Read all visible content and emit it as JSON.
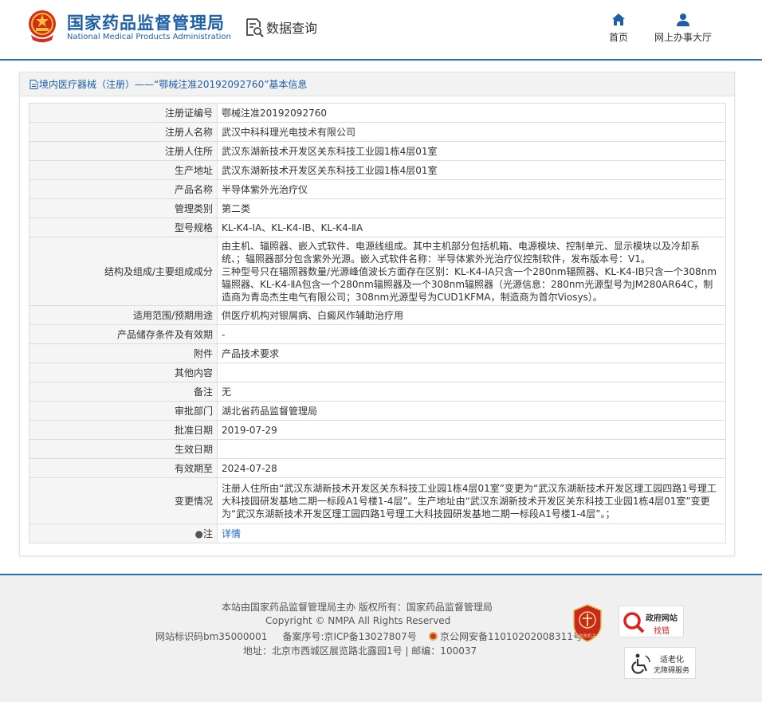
{
  "header": {
    "site_name_cn": "国家药品监督管理局",
    "site_name_en": "National Medical Products Administration",
    "query_label": "数据查询",
    "nav": {
      "home": "首页",
      "online_hall": "网上办事大厅"
    }
  },
  "panel": {
    "title": "境内医疗器械（注册）——“鄂械注准20192092760”基本信息",
    "rows": [
      {
        "label": "注册证编号",
        "value": "鄂械注准20192092760"
      },
      {
        "label": "注册人名称",
        "value": "武汉中科科理光电技术有限公司"
      },
      {
        "label": "注册人住所",
        "value": "武汉东湖新技术开发区关东科技工业园1栋4层01室"
      },
      {
        "label": "生产地址",
        "value": "武汉东湖新技术开发区关东科技工业园1栋4层01室"
      },
      {
        "label": "产品名称",
        "value": "半导体紫外光治疗仪"
      },
      {
        "label": "管理类别",
        "value": "第二类"
      },
      {
        "label": "型号规格",
        "value": "KL-K4-ⅠA、KL-K4-ⅠB、KL-K4-ⅡA"
      },
      {
        "label": "结构及组成/主要组成成分",
        "value": "由主机、辐照器、嵌入式软件、电源线组成。其中主机部分包括机箱、电源模块、控制单元、显示模块以及冷却系统、；辐照器部分包含紫外光源。嵌入式软件名称：半导体紫外光治疗仪控制软件，发布版本号：V1。\n三种型号只在辐照器数量/光源峰值波长方面存在区别：KL-K4-ⅠA只含一个280nm辐照器、KL-K4-ⅠB只含一个308nm辐照器、KL-K4-ⅡA包含一个280nm辐照器及一个308nm辐照器（光源信息：280nm光源型号为JM280AR64C，制造商为青岛杰生电气有限公司；308nm光源型号为CUD1KFMA，制造商为首尔Viosys）。"
      },
      {
        "label": "适用范围/预期用途",
        "value": "供医疗机构对银屑病、白癜风作辅助治疗用"
      },
      {
        "label": "产品储存条件及有效期",
        "value": "-"
      },
      {
        "label": "附件",
        "value": "产品技术要求"
      },
      {
        "label": "其他内容",
        "value": ""
      },
      {
        "label": "备注",
        "value": "无"
      },
      {
        "label": "审批部门",
        "value": "湖北省药品监督管理局"
      },
      {
        "label": "批准日期",
        "value": "2019-07-29"
      },
      {
        "label": "生效日期",
        "value": ""
      },
      {
        "label": "有效期至",
        "value": "2024-07-28"
      },
      {
        "label": "变更情况",
        "value": "注册人住所由“武汉东湖新技术开发区关东科技工业园1栋4层01室”变更为“武汉东湖新技术开发区理工园四路1号理工大科技园研发基地二期一标段A1号楼1-4层”。生产地址由“武汉东湖新技术开发区关东科技工业园1栋4层01室”变更为“武汉东湖新技术开发区理工园四路1号理工大科技园研发基地二期一标段A1号楼1-4层”。；"
      }
    ],
    "note": {
      "label": "注",
      "link": "详情"
    }
  },
  "footer": {
    "line1": "本站由国家药品监督管理局主办 版权所有：国家药品监督管理局",
    "line2": "Copyright © NMPA All Rights Reserved",
    "site_id": "网站标识码bm35000001",
    "icp": "备案序号:京ICP备13027807号",
    "police": "京公网安备11010202008311号",
    "address": "地址：北京市西城区展览路北露园1号 | 邮编：100037",
    "party_badge": "党政机关",
    "gov_site_title": "政府网站",
    "gov_site_sub": "找错",
    "elder_title": "适老化",
    "elder_sub": "无障碍服务"
  },
  "colors": {
    "brand_blue": "#1d5fa8",
    "divider_blue": "#2a6fb3",
    "link_blue": "#1d66c0",
    "badge_red": "#c8291f"
  }
}
